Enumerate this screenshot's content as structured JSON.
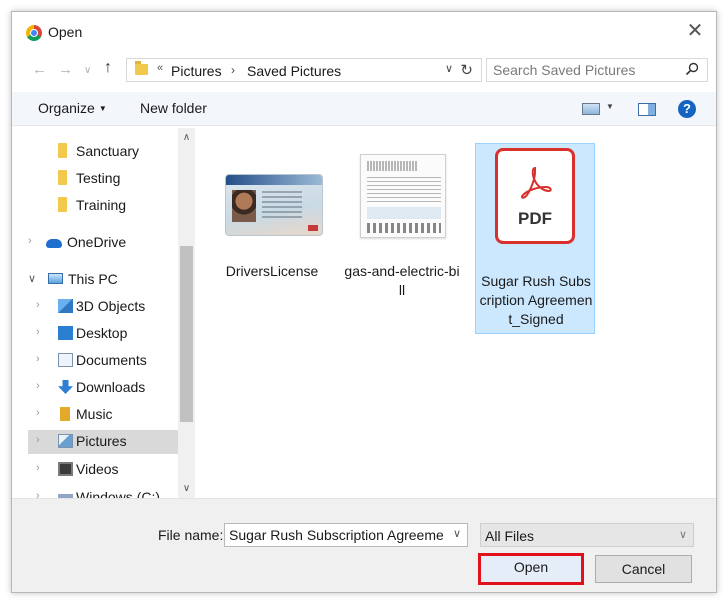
{
  "window": {
    "title": "Open",
    "close_label": "✕"
  },
  "address": {
    "breadcrumb_prefix": "«",
    "crumbs": [
      "Pictures",
      "Saved Pictures"
    ],
    "separator": "›",
    "dropdown": "∨",
    "refresh": "↻"
  },
  "search": {
    "placeholder": "Search Saved Pictures"
  },
  "nav_buttons": {
    "back": "←",
    "forward": "→",
    "recent": "∨",
    "up": "↑"
  },
  "toolbar": {
    "organize": "Organize",
    "organize_caret": "▼",
    "new_folder": "New folder",
    "view_caret": "▼",
    "help": "?"
  },
  "sidebar": {
    "items": [
      {
        "label": "Sanctuary",
        "icon": "folder-icon"
      },
      {
        "label": "Testing",
        "icon": "folder-icon"
      },
      {
        "label": "Training",
        "icon": "folder-icon"
      },
      {
        "label": "OneDrive",
        "icon": "onedrive-icon"
      },
      {
        "label": "This PC",
        "icon": "this-pc-icon"
      },
      {
        "label": "3D Objects",
        "icon": "3d-objects-icon"
      },
      {
        "label": "Desktop",
        "icon": "desktop-icon"
      },
      {
        "label": "Documents",
        "icon": "documents-icon"
      },
      {
        "label": "Downloads",
        "icon": "downloads-icon"
      },
      {
        "label": "Music",
        "icon": "music-icon"
      },
      {
        "label": "Pictures",
        "icon": "pictures-icon",
        "selected": true
      },
      {
        "label": "Videos",
        "icon": "videos-icon"
      },
      {
        "label": "Windows (C:)",
        "icon": "drive-icon"
      }
    ],
    "arrow_collapsed": "›",
    "arrow_expanded": "∨",
    "scroll_up": "∧",
    "scroll_down": "∨"
  },
  "files": [
    {
      "name": "DriversLicense",
      "type": "image"
    },
    {
      "name": "gas-and-electric-bill",
      "type": "image"
    },
    {
      "name": "Sugar Rush Subscription Agreement_Signed",
      "type": "pdf",
      "selected": true,
      "badge": "PDF"
    }
  ],
  "footer": {
    "file_name_label": "File name:",
    "file_name_value": "Sugar Rush Subscription Agreement",
    "file_type": "All Files",
    "open_label": "Open",
    "cancel_label": "Cancel",
    "dropdown": "∨"
  },
  "colors": {
    "selection": "#cce8ff",
    "highlight_border": "#e0111a",
    "pdf_red": "#d9302b"
  }
}
